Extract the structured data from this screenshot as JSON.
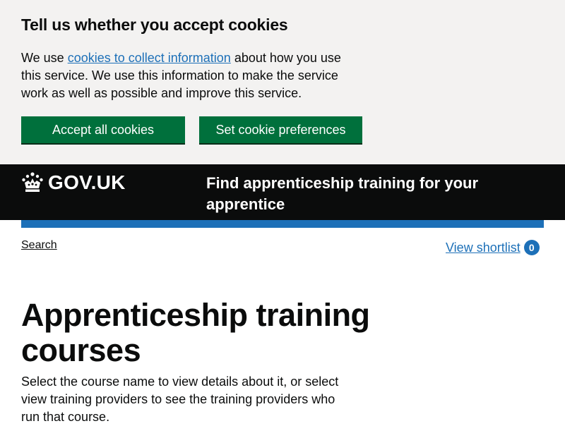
{
  "cookie_banner": {
    "heading": "Tell us whether you accept cookies",
    "text_before": "We use ",
    "link_text": "cookies to collect information",
    "text_after": " about how you use this service. We use this information to make the service work as well as possible and improve this service.",
    "accept_label": "Accept all cookies",
    "preferences_label": "Set cookie preferences"
  },
  "header": {
    "logo_text": "GOV.UK",
    "logo_icon": "crown-icon",
    "service_name": "Find apprenticeship training for your apprentice"
  },
  "nav": {
    "search_label": "Search",
    "shortlist_label": "View shortlist",
    "shortlist_count": "0"
  },
  "main": {
    "title": "Apprenticeship training courses",
    "lede": "Select the course name to view details about it, or select view training providers to see the training providers who run that course."
  },
  "colors": {
    "banner_bg": "#f3f2f1",
    "button_green": "#00703c",
    "header_black": "#0b0c0c",
    "link_blue": "#1d70b8"
  }
}
